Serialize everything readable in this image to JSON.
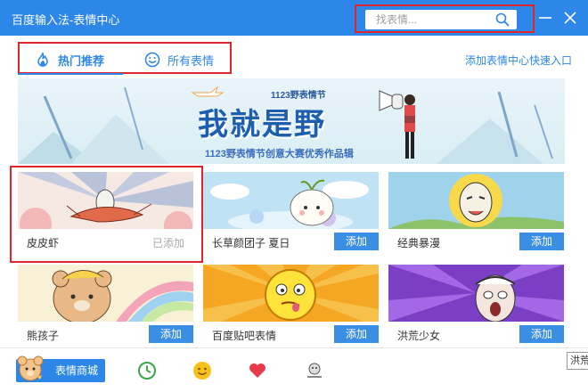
{
  "window": {
    "title": "百度输入法-表情中心",
    "search_placeholder": "找表情..."
  },
  "tabs": [
    {
      "label": "热门推荐",
      "icon": "fire-icon",
      "active": true
    },
    {
      "label": "所有表情",
      "icon": "smiley-icon",
      "active": false
    }
  ],
  "quick_entry_label": "添加表情中心快速入口",
  "banner": {
    "festival": "1123野表情节",
    "slogan": "我就是野",
    "sub": "1123野表情节创意大赛优秀作品辑"
  },
  "cards": [
    {
      "name": "皮皮虾",
      "action": "已添加",
      "added": true
    },
    {
      "name": "长草颜团子 夏日",
      "action": "添加",
      "added": false
    },
    {
      "name": "经典暴漫",
      "action": "添加",
      "added": false
    },
    {
      "name": "熊孩子",
      "action": "添加",
      "added": false
    },
    {
      "name": "百度贴吧表情",
      "action": "添加",
      "added": false
    },
    {
      "name": "洪荒少女",
      "action": "添加",
      "added": false
    }
  ],
  "bottom": {
    "shop_label": "表情商城",
    "icons": [
      "clock-icon",
      "smiley-face-icon",
      "heart-icon",
      "sticker-thumbnail-icon"
    ],
    "tooltip": "洪荒"
  },
  "colors": {
    "brand_blue": "#2c87e8",
    "button_blue": "#3a8ee6",
    "highlight_red": "#e0262b",
    "added_gray": "#aaaaaa"
  }
}
